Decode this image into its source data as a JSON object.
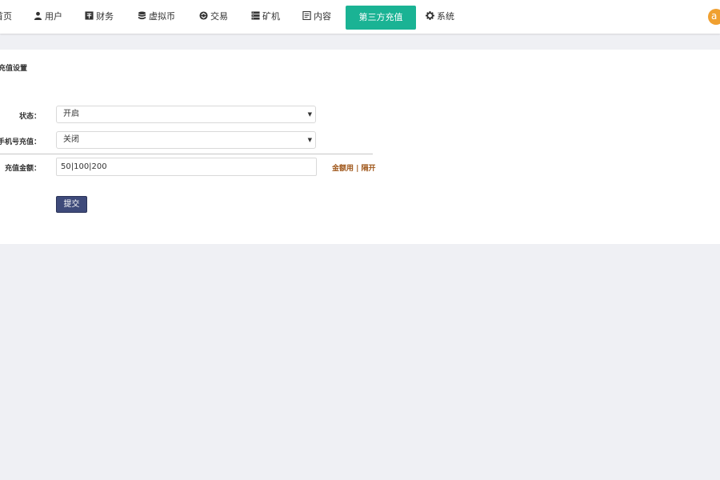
{
  "nav": {
    "items": [
      {
        "label": "首页",
        "icon": "home-icon"
      },
      {
        "label": "用户",
        "icon": "user-icon"
      },
      {
        "label": "财务",
        "icon": "finance-icon"
      },
      {
        "label": "虚拟币",
        "icon": "coin-stack-icon"
      },
      {
        "label": "交易",
        "icon": "exchange-icon"
      },
      {
        "label": "矿机",
        "icon": "server-icon"
      },
      {
        "label": "内容",
        "icon": "document-icon"
      },
      {
        "label": "第三方充值",
        "icon": ""
      },
      {
        "label": "系统",
        "icon": "gear-icon"
      }
    ],
    "active_index": 7,
    "avatar_initial": "a",
    "active_color": "#1ab394",
    "avatar_color": "#f0a030"
  },
  "panel": {
    "title": "充值设置"
  },
  "form": {
    "status": {
      "label": "状态：",
      "value": "开启"
    },
    "phone_recharge": {
      "label": "绑定手机号充值：",
      "value": "关闭"
    },
    "amount": {
      "label": "充值金额：",
      "value": "50|100|200",
      "hint": "金额用 | 隔开"
    },
    "submit_label": "提交",
    "submit_color": "#3e4a7a",
    "hint_color": "#a0581c"
  }
}
